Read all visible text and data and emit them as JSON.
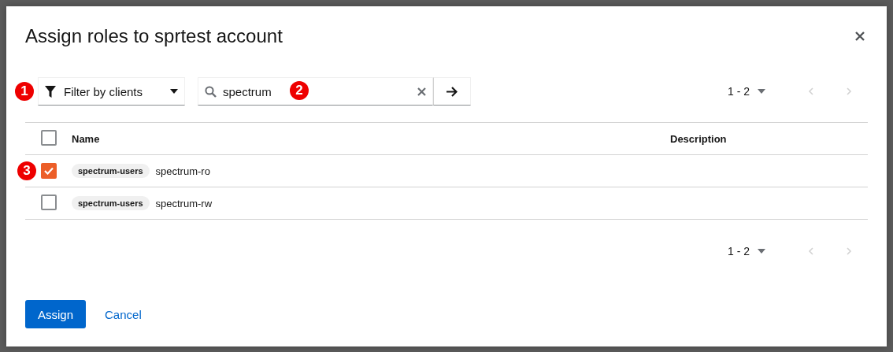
{
  "dialog": {
    "title": "Assign roles to sprtest account"
  },
  "filter": {
    "label": "Filter by clients",
    "badge": "1"
  },
  "search": {
    "value": "spectrum",
    "badge": "2"
  },
  "pagination_top": {
    "range": "1 - 2",
    "prev_disabled": true,
    "next_disabled": true
  },
  "table": {
    "columns": [
      "Name",
      "Description"
    ],
    "header_checked": false,
    "rows": [
      {
        "client": "spectrum-users",
        "name": "spectrum-ro",
        "checked": true,
        "badge": "3"
      },
      {
        "client": "spectrum-users",
        "name": "spectrum-rw",
        "checked": false
      }
    ]
  },
  "pagination_bottom": {
    "range": "1 - 2",
    "prev_disabled": true,
    "next_disabled": true
  },
  "buttons": [
    {
      "label": "Assign",
      "kind": "primary"
    },
    {
      "label": "Cancel",
      "kind": "link"
    }
  ]
}
